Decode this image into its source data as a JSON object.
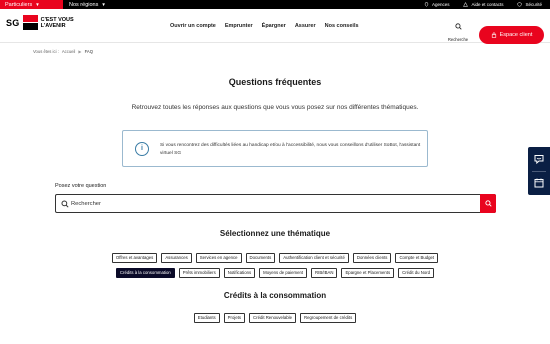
{
  "topbar": {
    "segment_active": "Particuliers",
    "segment_region": "Nos régions",
    "links": [
      {
        "label": "Agences",
        "icon": "location-pin-icon"
      },
      {
        "label": "Aide et contacts",
        "icon": "warning-triangle-icon"
      },
      {
        "label": "Sécurité",
        "icon": "shield-icon"
      }
    ]
  },
  "header": {
    "logo_sg": "SG",
    "logo_tag_line1": "C'EST VOUS",
    "logo_tag_line2": "L'AVENIR",
    "nav": [
      "Ouvrir un compte",
      "Emprunter",
      "Épargner",
      "Assurer",
      "Nos conseils"
    ],
    "search_label": "Recherche",
    "espace_client": "Espace client"
  },
  "breadcrumb": {
    "prefix": "Vous êtes ici :",
    "home": "Accueil",
    "current": "FAQ"
  },
  "main": {
    "title": "Questions fréquentes",
    "subtitle": "Retrouvez toutes les réponses aux questions que vous vous posez sur nos différentes thématiques.",
    "info_text": "Si vous rencontrez des difficultés liées au handicap et/ou à l'accessibilité, nous vous conseillons d'utiliser SoBot, l'assistant virtuel SG",
    "search_label": "Posez votre question",
    "search_placeholder": "Rechercher"
  },
  "themes": {
    "title": "Sélectionnez une thématique",
    "row1": [
      "Offres et avantages",
      "Assurances",
      "Services en agence",
      "Documents",
      "Authentification client et sécurité",
      "Données clients",
      "Compte et Budget"
    ],
    "row2": [
      "Crédits à la consommation",
      "Prêts immobiliers",
      "Notifications",
      "Moyens de paiement",
      "RIB/IBAN",
      "Epargne et Placements",
      "Crédit du Nord"
    ],
    "active": "Crédits à la consommation"
  },
  "subthemes": {
    "title": "Crédits à la consommation",
    "items": [
      "Etudiants",
      "Projets",
      "Crédit Renouvelable",
      "Regroupement de crédits"
    ]
  },
  "colors": {
    "brand_red": "#e9041e",
    "navy": "#0a0a28",
    "info_blue": "#3a7ca5"
  }
}
